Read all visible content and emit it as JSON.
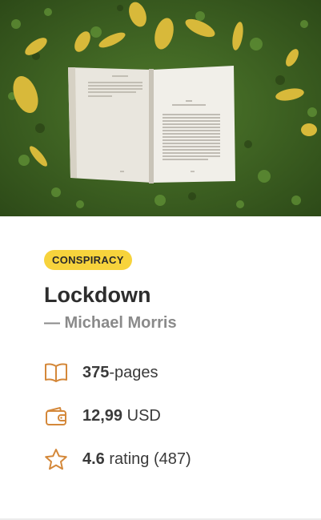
{
  "book": {
    "category": "CONSPIRACY",
    "title": "Lockdown",
    "author": "— Michael Morris"
  },
  "stats": {
    "pages_value": "375",
    "pages_unit": "-pages",
    "price_value": "12,99",
    "price_unit": " USD",
    "rating_value": "4.6",
    "rating_text": " rating (487)"
  },
  "colors": {
    "accent_icon": "#d4883a",
    "badge": "#f7d33c"
  },
  "icons": [
    "open-book-icon",
    "wallet-icon",
    "star-icon"
  ]
}
